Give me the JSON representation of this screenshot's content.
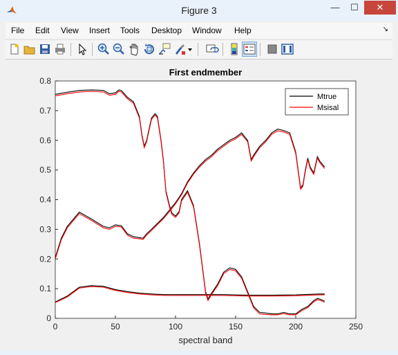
{
  "window": {
    "title": "Figure 3",
    "controls": {
      "minimize": "—",
      "maximize": "☐",
      "close": "✕"
    }
  },
  "menu": {
    "items": [
      "File",
      "Edit",
      "View",
      "Insert",
      "Tools",
      "Desktop",
      "Window",
      "Help"
    ],
    "dock_arrow": "↘"
  },
  "toolbar": {
    "icons": [
      "new-figure-icon",
      "open-file-icon",
      "save-icon",
      "print-icon",
      "pointer-icon",
      "zoom-in-icon",
      "zoom-out-icon",
      "pan-icon",
      "rotate-3d-icon",
      "data-cursor-icon",
      "brush-icon",
      "brush-dropdown-icon",
      "link-plot-icon",
      "colorbar-icon",
      "legend-icon",
      "hide-plot-tools-icon",
      "show-plot-tools-icon"
    ]
  },
  "colors": {
    "mtrue": "#000000",
    "msisal": "#ff0000",
    "axes_bg": "#ffffff",
    "close_button": "#c7463b"
  },
  "chart_data": {
    "type": "line",
    "title": "First endmember",
    "xlabel": "spectral band",
    "ylabel": "",
    "xlim": [
      0,
      250
    ],
    "ylim": [
      0,
      0.8
    ],
    "xticks": [
      0,
      50,
      100,
      150,
      200,
      250
    ],
    "yticks": [
      0,
      0.1,
      0.2,
      0.3,
      0.4,
      0.5,
      0.6,
      0.7,
      0.8
    ],
    "ytick_labels": [
      "0",
      "0.1",
      "0.2",
      "0.3",
      "0.4",
      "0.5",
      "0.6",
      "0.7",
      "0.8"
    ],
    "grid": false,
    "legend": {
      "position": "top-right",
      "entries": [
        "Mtrue",
        "Msisal"
      ]
    },
    "series": [
      {
        "name": "Mtrue",
        "curves": [
          {
            "x": [
              0,
              5,
              10,
              20,
              30,
              40,
              45,
              50,
              55,
              60,
              65,
              70,
              73,
              76,
              80,
              85,
              90,
              95,
              100,
              105,
              110,
              115,
              120,
              125,
              130,
              135,
              140,
              145,
              150,
              155,
              160,
              163,
              165,
              170,
              175,
              180,
              185,
              190,
              195,
              200,
              202,
              204,
              206,
              208,
              210,
              212,
              215,
              218,
              220,
              224
            ],
            "y": [
              0.205,
              0.27,
              0.31,
              0.358,
              0.335,
              0.31,
              0.305,
              0.315,
              0.312,
              0.285,
              0.275,
              0.272,
              0.27,
              0.285,
              0.3,
              0.32,
              0.34,
              0.365,
              0.39,
              0.42,
              0.46,
              0.49,
              0.515,
              0.535,
              0.55,
              0.57,
              0.585,
              0.6,
              0.61,
              0.625,
              0.6,
              0.535,
              0.55,
              0.58,
              0.6,
              0.625,
              0.638,
              0.633,
              0.625,
              0.56,
              0.5,
              0.44,
              0.45,
              0.5,
              0.54,
              0.51,
              0.49,
              0.545,
              0.53,
              0.51
            ]
          },
          {
            "x": [
              0,
              10,
              20,
              30,
              40,
              45,
              50,
              53,
              55,
              60,
              65,
              70,
              72,
              74,
              76,
              80,
              83,
              85,
              88,
              90,
              92,
              95,
              97,
              100,
              103,
              105,
              110,
              115,
              120,
              125,
              127,
              130,
              135,
              140,
              145,
              150,
              155,
              160,
              165,
              170,
              175,
              180,
              185,
              190,
              195,
              200,
              205,
              210,
              215,
              218,
              220,
              224
            ],
            "y": [
              0.755,
              0.762,
              0.768,
              0.77,
              0.768,
              0.757,
              0.76,
              0.77,
              0.768,
              0.745,
              0.73,
              0.68,
              0.62,
              0.58,
              0.6,
              0.675,
              0.69,
              0.68,
              0.6,
              0.53,
              0.43,
              0.38,
              0.355,
              0.345,
              0.36,
              0.4,
              0.43,
              0.38,
              0.25,
              0.09,
              0.065,
              0.085,
              0.115,
              0.155,
              0.17,
              0.165,
              0.14,
              0.09,
              0.04,
              0.02,
              0.018,
              0.015,
              0.015,
              0.02,
              0.015,
              0.015,
              0.03,
              0.04,
              0.06,
              0.067,
              0.065,
              0.058
            ]
          },
          {
            "x": [
              0,
              10,
              20,
              30,
              40,
              50,
              60,
              70,
              80,
              90,
              100,
              120,
              140,
              160,
              180,
              200,
              220,
              224
            ],
            "y": [
              0.055,
              0.075,
              0.105,
              0.11,
              0.108,
              0.097,
              0.09,
              0.085,
              0.082,
              0.08,
              0.08,
              0.08,
              0.08,
              0.078,
              0.078,
              0.079,
              0.082,
              0.082
            ]
          }
        ]
      },
      {
        "name": "Msisal",
        "curves": [
          {
            "x": [
              0,
              5,
              10,
              20,
              30,
              40,
              45,
              50,
              55,
              60,
              65,
              70,
              73,
              76,
              80,
              85,
              90,
              95,
              100,
              105,
              110,
              115,
              120,
              125,
              130,
              135,
              140,
              145,
              150,
              155,
              160,
              163,
              165,
              170,
              175,
              180,
              185,
              190,
              195,
              200,
              202,
              204,
              206,
              208,
              210,
              212,
              215,
              218,
              220,
              224
            ],
            "y": [
              0.2,
              0.265,
              0.305,
              0.353,
              0.33,
              0.305,
              0.3,
              0.31,
              0.308,
              0.28,
              0.27,
              0.268,
              0.266,
              0.28,
              0.296,
              0.316,
              0.336,
              0.36,
              0.386,
              0.416,
              0.456,
              0.486,
              0.51,
              0.53,
              0.545,
              0.565,
              0.58,
              0.595,
              0.605,
              0.62,
              0.595,
              0.53,
              0.545,
              0.575,
              0.595,
              0.62,
              0.632,
              0.628,
              0.62,
              0.555,
              0.495,
              0.435,
              0.445,
              0.495,
              0.535,
              0.505,
              0.485,
              0.54,
              0.525,
              0.505
            ]
          },
          {
            "x": [
              0,
              10,
              20,
              30,
              40,
              45,
              50,
              53,
              55,
              60,
              65,
              70,
              72,
              74,
              76,
              80,
              83,
              85,
              88,
              90,
              92,
              95,
              97,
              100,
              103,
              105,
              110,
              115,
              120,
              125,
              127,
              130,
              135,
              140,
              145,
              150,
              155,
              160,
              165,
              170,
              175,
              180,
              185,
              190,
              195,
              200,
              205,
              210,
              215,
              218,
              220,
              224
            ],
            "y": [
              0.75,
              0.757,
              0.763,
              0.765,
              0.763,
              0.752,
              0.755,
              0.765,
              0.763,
              0.74,
              0.725,
              0.675,
              0.615,
              0.575,
              0.595,
              0.67,
              0.685,
              0.675,
              0.595,
              0.525,
              0.425,
              0.375,
              0.35,
              0.34,
              0.355,
              0.395,
              0.425,
              0.375,
              0.245,
              0.085,
              0.06,
              0.08,
              0.11,
              0.15,
              0.165,
              0.16,
              0.135,
              0.085,
              0.035,
              0.015,
              0.013,
              0.012,
              0.012,
              0.016,
              0.012,
              0.012,
              0.026,
              0.036,
              0.056,
              0.063,
              0.061,
              0.054
            ]
          },
          {
            "x": [
              0,
              10,
              20,
              30,
              40,
              50,
              60,
              70,
              80,
              90,
              100,
              120,
              140,
              160,
              180,
              200,
              220,
              224
            ],
            "y": [
              0.053,
              0.072,
              0.102,
              0.107,
              0.105,
              0.094,
              0.087,
              0.082,
              0.079,
              0.077,
              0.077,
              0.077,
              0.077,
              0.075,
              0.075,
              0.076,
              0.079,
              0.079
            ]
          }
        ]
      }
    ]
  }
}
